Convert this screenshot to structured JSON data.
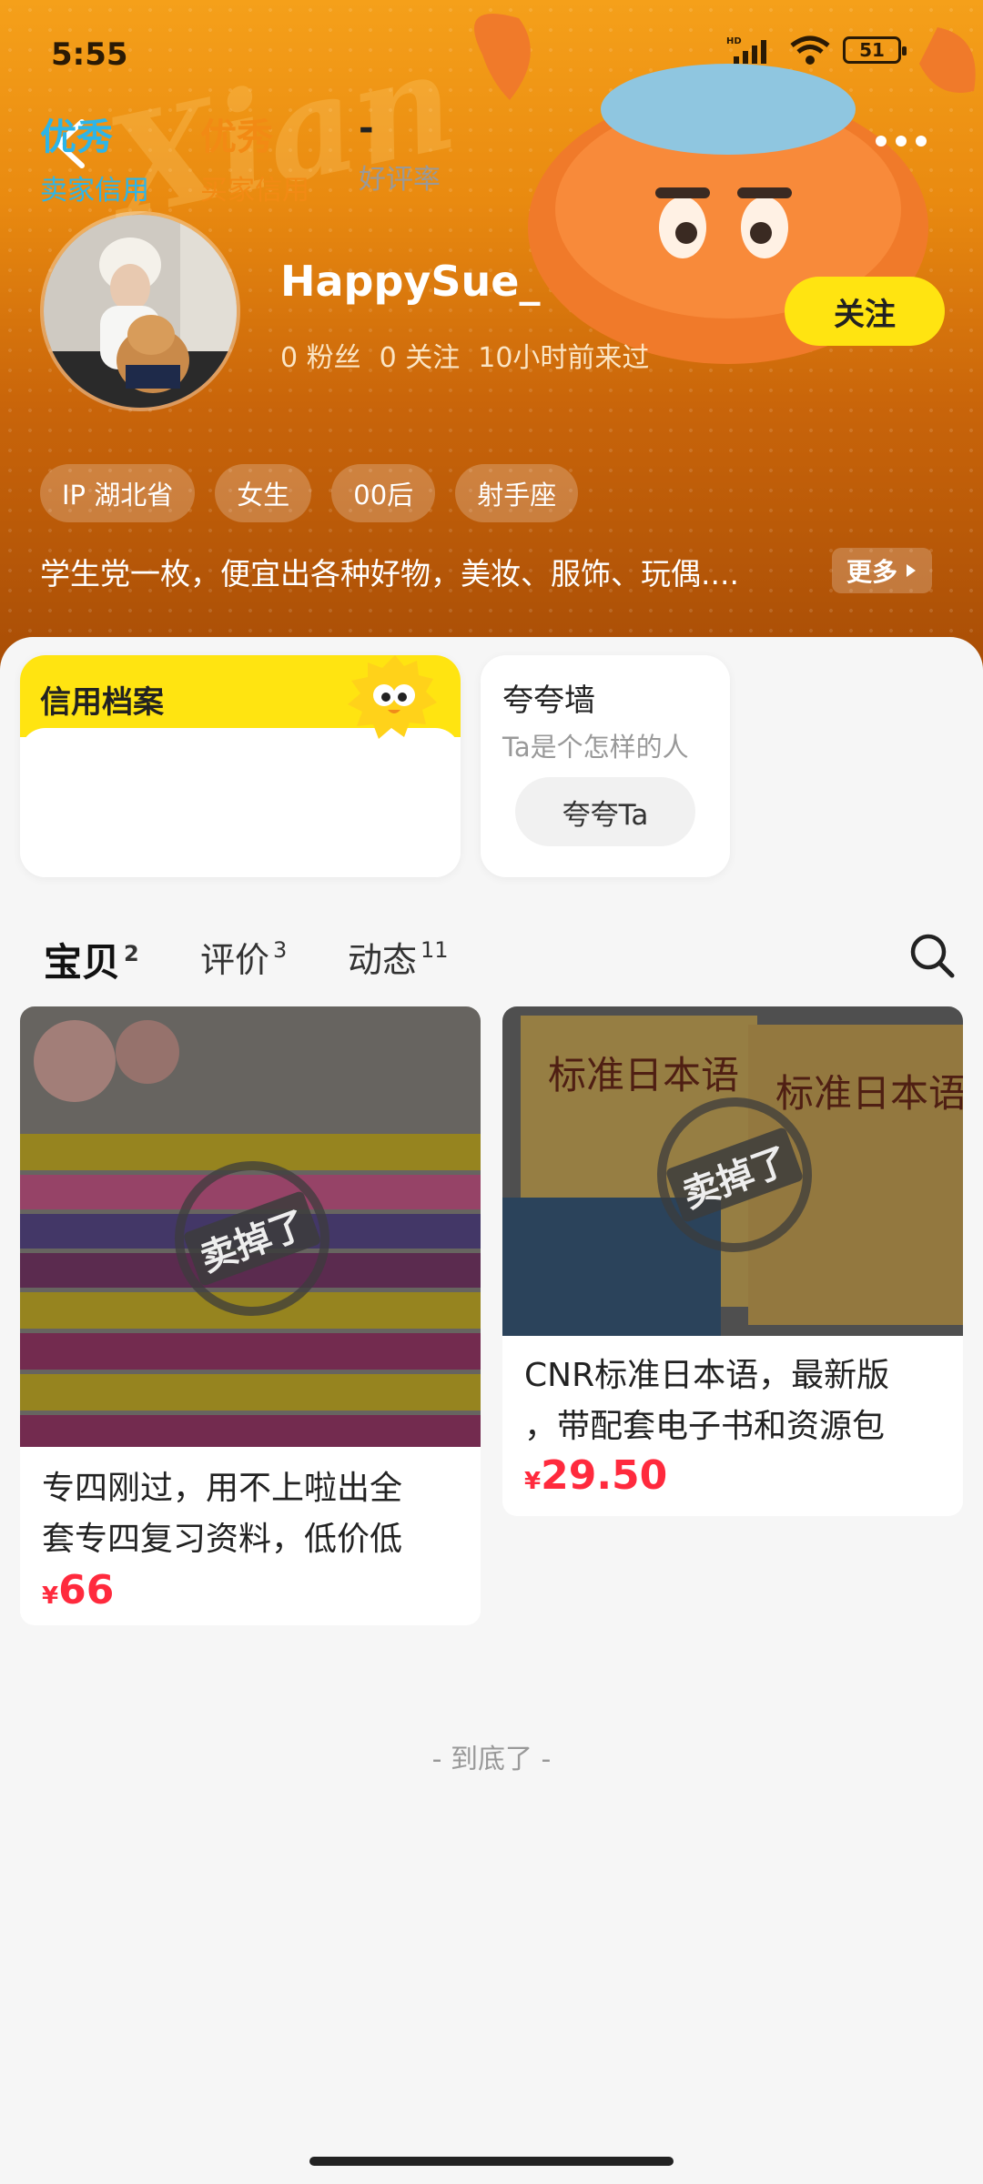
{
  "status_bar": {
    "time": "5:55",
    "battery": "51",
    "network": "HD"
  },
  "profile": {
    "username": "HappySue_",
    "stats": [
      "0 粉丝",
      "0 关注",
      "10小时前来过"
    ],
    "follow_label": "关注",
    "tags": [
      "IP 湖北省",
      "女生",
      "00后",
      "射手座"
    ],
    "bio": "学生党一枚，便宜出各种好物，美妆、服饰、玩偶....",
    "bio_more": "更多"
  },
  "credit": {
    "title": "信用档案",
    "items": [
      {
        "value": "优秀",
        "label": "卖家信用",
        "color": "#2db5e8"
      },
      {
        "value": "优秀",
        "label": "买家信用",
        "color": "#f28a14"
      },
      {
        "value": "-",
        "label": "好评率",
        "color": "#222222"
      }
    ]
  },
  "praise": {
    "title": "夸夸墙",
    "subtitle": "Ta是个怎样的人",
    "button": "夸夸Ta"
  },
  "tabs": [
    {
      "label": "宝贝",
      "count": "2",
      "active": true
    },
    {
      "label": "评价",
      "count": "3",
      "active": false
    },
    {
      "label": "动态",
      "count": "11",
      "active": false
    }
  ],
  "products": [
    {
      "title_line1": "专四刚过，用不上啦出全",
      "title_line2": "套专四复习资料，低价低",
      "currency": "¥",
      "price": "66",
      "stamp": "卖掉了"
    },
    {
      "title_line1": "CNR标准日本语，最新版",
      "title_line2": "，带配套电子书和资源包",
      "currency": "¥",
      "price": "29.50",
      "stamp": "卖掉了"
    }
  ],
  "bottom_tip": "- 到底了 -",
  "colors": {
    "accent_yellow": "#ffe411",
    "price_red": "#ff2a3d"
  }
}
